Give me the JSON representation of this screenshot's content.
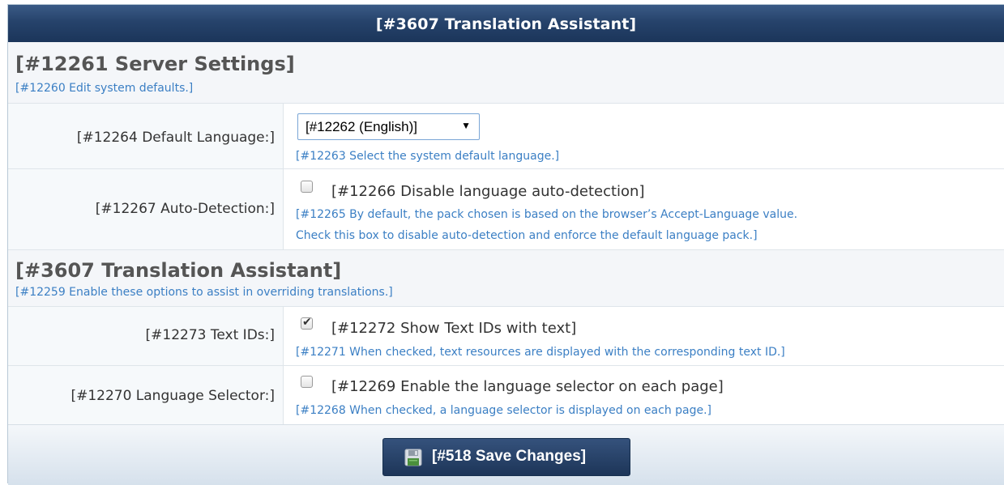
{
  "window": {
    "title": "[#3607 Translation Assistant]"
  },
  "server_settings": {
    "heading": "[#12261 Server Settings]",
    "subtitle": "[#12260 Edit system defaults.]",
    "default_language": {
      "label": "[#12264 Default Language:]",
      "selected": "[#12262 (English)]",
      "help": "[#12263 Select the system default language.]"
    },
    "auto_detection": {
      "label": "[#12267 Auto-Detection:]",
      "checkbox_label": "[#12266 Disable language auto-detection]",
      "checked": false,
      "help_line1": "[#12265 By default, the pack chosen is based on the browser’s Accept-Language value.",
      "help_line2": "Check this box to disable auto-detection and enforce the default language pack.]"
    }
  },
  "translation_assistant": {
    "heading": "[#3607 Translation Assistant]",
    "subtitle": "[#12259 Enable these options to assist in overriding translations.]",
    "text_ids": {
      "label": "[#12273 Text IDs:]",
      "checkbox_label": "[#12272 Show Text IDs with text]",
      "checked": true,
      "help": "[#12271 When checked, text resources are displayed with the corresponding text ID.]"
    },
    "language_selector": {
      "label": "[#12270 Language Selector:]",
      "checkbox_label": "[#12269 Enable the language selector on each page]",
      "checked": false,
      "help": "[#12268 When checked, a language selector is displayed on each page.]"
    }
  },
  "footer": {
    "save_label": "[#518 Save Changes]"
  },
  "colors": {
    "titlebar": "#26436b",
    "link_blue": "#3b7fc4",
    "heading_gray": "#555555"
  },
  "icons": {
    "save": "floppy-disk-icon",
    "dropdown": "caret-down-icon",
    "check": "checkmark-icon"
  }
}
